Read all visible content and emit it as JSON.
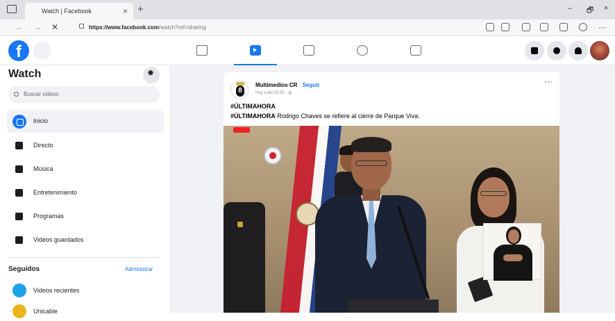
{
  "browser": {
    "tab_title": "Watch | Facebook",
    "tab_close": "×",
    "new_tab": "+",
    "url_host": "https://www.facebook.com",
    "url_path": "/watch?ref=sharing",
    "win_min": "–",
    "win_max": "🗗",
    "win_close": "×"
  },
  "sidebar": {
    "title": "Watch",
    "search_placeholder": "Buscar videos",
    "items": [
      {
        "label": "Inicio",
        "icon": "watch-play-icon"
      },
      {
        "label": "Directo",
        "icon": "live-camera-icon"
      },
      {
        "label": "Música",
        "icon": "music-note-icon"
      },
      {
        "label": "Entretenimiento",
        "icon": "entertainment-icon"
      },
      {
        "label": "Programas",
        "icon": "shows-icon"
      },
      {
        "label": "Videos guardados",
        "icon": "bookmark-icon"
      }
    ],
    "following_title": "Seguidos",
    "manage_label": "Administrar",
    "following": [
      {
        "label": "Videos recientes",
        "color": "#1fa3e8"
      },
      {
        "label": "Unicable",
        "color": "#e9b51c"
      }
    ]
  },
  "post": {
    "author": "Multimedios CR",
    "separator": "·",
    "follow": "Seguir",
    "time": "Hoy a las 15:33 · ",
    "more": "···",
    "hashtag": "#ÚLTIMAHORA",
    "body_tag": "#ÚLTIMAHORA",
    "body_text": " Rodrigo Chaves se refiere al cierre de Parque Viva."
  },
  "colors": {
    "brand": "#1877f2",
    "page_bg": "#f0f2f5"
  }
}
